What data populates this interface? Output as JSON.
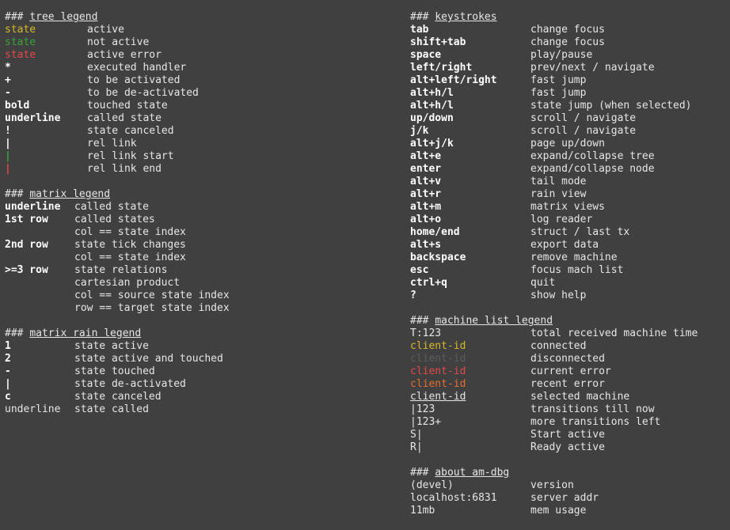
{
  "tree_legend": {
    "title": "tree legend",
    "rows": [
      {
        "key": "state",
        "value": "active"
      },
      {
        "key": "state",
        "value": "not active"
      },
      {
        "key": "state",
        "value": "active error"
      },
      {
        "key": "*",
        "value": "executed handler"
      },
      {
        "key": "+",
        "value": "to be activated"
      },
      {
        "key": "-",
        "value": "to be de-activated"
      },
      {
        "key": "bold",
        "value": "touched state"
      },
      {
        "key": "underline",
        "value": "called state"
      },
      {
        "key": "!",
        "value": "state canceled"
      },
      {
        "key": "|",
        "value": "rel link"
      },
      {
        "key": "|",
        "value": "rel link start"
      },
      {
        "key": "|",
        "value": "rel link end"
      }
    ]
  },
  "matrix_legend": {
    "title": "matrix legend",
    "rows": [
      {
        "key": "underline",
        "value": "called state"
      },
      {
        "key": "1st row",
        "value": "called states"
      },
      {
        "key": "",
        "value": "col == state index"
      },
      {
        "key": "2nd row",
        "value": "state tick changes"
      },
      {
        "key": "",
        "value": "col == state index"
      },
      {
        "key": ">=3 row",
        "value": "state relations"
      },
      {
        "key": "",
        "value": "cartesian product"
      },
      {
        "key": "",
        "value": "col == source state index"
      },
      {
        "key": "",
        "value": "row == target state index"
      }
    ]
  },
  "matrix_rain_legend": {
    "title": "matrix rain legend",
    "rows": [
      {
        "key": "1",
        "value": "state active"
      },
      {
        "key": "2",
        "value": "state active and touched"
      },
      {
        "key": "-",
        "value": "state touched"
      },
      {
        "key": "|",
        "value": "state de-activated"
      },
      {
        "key": "c",
        "value": "state canceled"
      },
      {
        "key": "underline",
        "value": "state called"
      }
    ]
  },
  "keystrokes": {
    "title": "keystrokes",
    "rows": [
      {
        "key": "tab",
        "value": "change focus"
      },
      {
        "key": "shift+tab",
        "value": "change focus"
      },
      {
        "key": "space",
        "value": "play/pause"
      },
      {
        "key": "left/right",
        "value": "prev/next / navigate"
      },
      {
        "key": "alt+left/right",
        "value": "fast jump"
      },
      {
        "key": "alt+h/l",
        "value": "fast jump"
      },
      {
        "key": "alt+h/l",
        "value": "state jump (when selected)"
      },
      {
        "key": "up/down",
        "value": "scroll / navigate"
      },
      {
        "key": "j/k",
        "value": "scroll / navigate"
      },
      {
        "key": "alt+j/k",
        "value": "page up/down"
      },
      {
        "key": "alt+e",
        "value": "expand/collapse tree"
      },
      {
        "key": "enter",
        "value": "expand/collapse node"
      },
      {
        "key": "alt+v",
        "value": "tail mode"
      },
      {
        "key": "alt+r",
        "value": "rain view"
      },
      {
        "key": "alt+m",
        "value": "matrix views"
      },
      {
        "key": "alt+o",
        "value": "log reader"
      },
      {
        "key": "home/end",
        "value": "struct / last tx"
      },
      {
        "key": "alt+s",
        "value": "export data"
      },
      {
        "key": "backspace",
        "value": "remove machine"
      },
      {
        "key": "esc",
        "value": "focus mach list"
      },
      {
        "key": "ctrl+q",
        "value": "quit"
      },
      {
        "key": "?",
        "value": "show help"
      }
    ]
  },
  "machine_list_legend": {
    "title": "machine list legend",
    "rows": [
      {
        "key": "T:123",
        "value": "total received machine time"
      },
      {
        "key": "client-id",
        "value": "connected"
      },
      {
        "key": "client-id",
        "value": "disconnected"
      },
      {
        "key": "client-id",
        "value": "current error"
      },
      {
        "key": "client-id",
        "value": "recent error"
      },
      {
        "key": "client-id",
        "value": "selected machine"
      },
      {
        "key": "|123",
        "value": "transitions till now"
      },
      {
        "key": "|123+",
        "value": "more transitions left"
      },
      {
        "key": "S|",
        "value": "Start active"
      },
      {
        "key": "R|",
        "value": "Ready active"
      }
    ]
  },
  "about": {
    "title": "about am-dbg",
    "rows": [
      {
        "key": "(devel)",
        "value": "version"
      },
      {
        "key": "localhost:6831",
        "value": "server addr"
      },
      {
        "key": "11mb",
        "value": "mem usage"
      }
    ]
  },
  "heading_prefix": "### ",
  "colors": {
    "background": "#404040",
    "text": "#e6e6e6",
    "active": "#d7b82c",
    "not_active": "#3aa33a",
    "error": "#e04a4a",
    "disconnected": "#5c5c5c",
    "recent_error": "#e0702e"
  }
}
